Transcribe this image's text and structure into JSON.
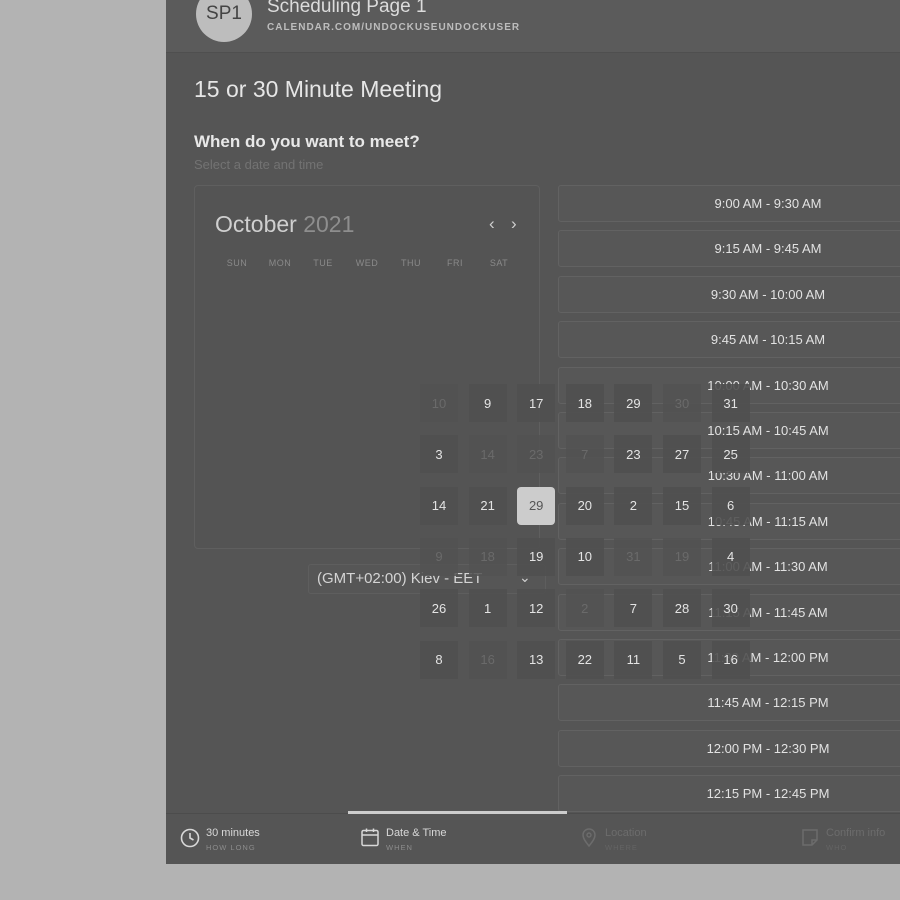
{
  "header": {
    "avatar_initials": "SP1",
    "page_name": "Scheduling Page 1",
    "page_url": "CALENDAR.COM/UNDOCKUSEUNDOCKUSER"
  },
  "meeting": {
    "title": "15 or 30 Minute Meeting",
    "question": "When do you want to meet?",
    "subtitle": "Select a date and time"
  },
  "calendar": {
    "month": "October",
    "year": "2021",
    "prev_icon": "‹",
    "next_icon": "›",
    "weekdays": [
      "SUN",
      "MON",
      "TUE",
      "WED",
      "THU",
      "FRI",
      "SAT"
    ],
    "days": [
      {
        "label": "10",
        "state": "dim"
      },
      {
        "label": "9",
        "state": "avail"
      },
      {
        "label": "17",
        "state": "avail"
      },
      {
        "label": "18",
        "state": "avail"
      },
      {
        "label": "29",
        "state": "avail"
      },
      {
        "label": "30",
        "state": "dim"
      },
      {
        "label": "31",
        "state": "avail"
      },
      {
        "label": "3",
        "state": "avail"
      },
      {
        "label": "14",
        "state": "dim"
      },
      {
        "label": "23",
        "state": "dim"
      },
      {
        "label": "7",
        "state": "dim"
      },
      {
        "label": "23",
        "state": "avail"
      },
      {
        "label": "27",
        "state": "avail"
      },
      {
        "label": "25",
        "state": "avail"
      },
      {
        "label": "14",
        "state": "avail"
      },
      {
        "label": "21",
        "state": "avail"
      },
      {
        "label": "29",
        "state": "selected"
      },
      {
        "label": "20",
        "state": "avail"
      },
      {
        "label": "2",
        "state": "avail"
      },
      {
        "label": "15",
        "state": "avail"
      },
      {
        "label": "6",
        "state": "avail"
      },
      {
        "label": "9",
        "state": "dim"
      },
      {
        "label": "18",
        "state": "dim"
      },
      {
        "label": "19",
        "state": "avail"
      },
      {
        "label": "10",
        "state": "avail"
      },
      {
        "label": "31",
        "state": "dim"
      },
      {
        "label": "19",
        "state": "dim"
      },
      {
        "label": "4",
        "state": "avail"
      },
      {
        "label": "26",
        "state": "avail"
      },
      {
        "label": "1",
        "state": "avail"
      },
      {
        "label": "12",
        "state": "avail"
      },
      {
        "label": "2",
        "state": "dim"
      },
      {
        "label": "7",
        "state": "avail"
      },
      {
        "label": "28",
        "state": "avail"
      },
      {
        "label": "30",
        "state": "avail"
      },
      {
        "label": "8",
        "state": "avail"
      },
      {
        "label": "16",
        "state": "dim"
      },
      {
        "label": "13",
        "state": "avail"
      },
      {
        "label": "22",
        "state": "avail"
      },
      {
        "label": "11",
        "state": "avail"
      },
      {
        "label": "5",
        "state": "avail"
      },
      {
        "label": "16",
        "state": "avail"
      }
    ]
  },
  "timezone": {
    "label": "(GMT+02:00) Kiev - EET",
    "arrow_icon": "⌄"
  },
  "time_slots": [
    "9:00 AM - 9:30 AM",
    "9:15 AM - 9:45 AM",
    "9:30 AM - 10:00 AM",
    "9:45 AM - 10:15 AM",
    "10:00 AM - 10:30 AM",
    "10:15 AM - 10:45 AM",
    "10:30 AM - 11:00 AM",
    "10:45 AM - 11:15 AM",
    "11:00 AM - 11:30 AM",
    "11:15 AM - 11:45 AM",
    "11:30 AM - 12:00 PM",
    "11:45 AM - 12:15 PM",
    "12:00 PM - 12:30 PM",
    "12:15 PM - 12:45 PM"
  ],
  "steps": [
    {
      "main": "30 minutes",
      "sub": "HOW LONG",
      "icon": "clock-icon"
    },
    {
      "main": "Date & Time",
      "sub": "WHEN",
      "icon": "calendar-icon"
    },
    {
      "main": "Location",
      "sub": "WHERE",
      "icon": "location-pin-icon"
    },
    {
      "main": "Confirm info",
      "sub": "WHO",
      "icon": "note-icon"
    }
  ],
  "colors": {
    "background": "#b3b3b3",
    "panel": "#555555",
    "selected_day": "#cccccc"
  }
}
